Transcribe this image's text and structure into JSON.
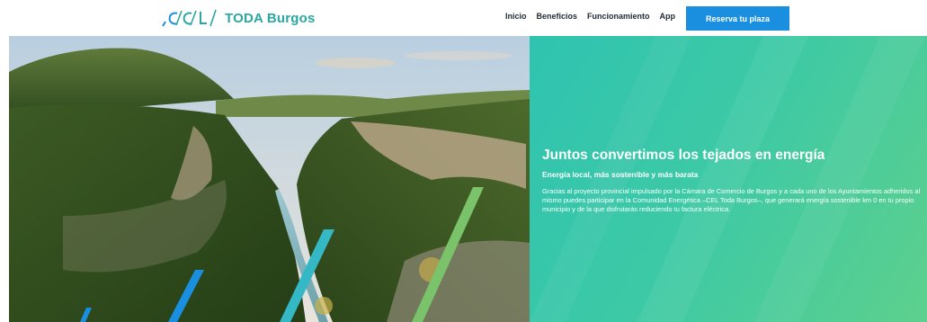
{
  "header": {
    "logo": {
      "mark_text": ",C/C/L",
      "brand": "TODA Burgos",
      "icon": "cel-logo-icon",
      "mark_color": "#1a8fe0",
      "brand_color": "#2aa7a0"
    },
    "nav": [
      {
        "label": "Inicio"
      },
      {
        "label": "Beneficios"
      },
      {
        "label": "Funcionamiento"
      },
      {
        "label": "App"
      }
    ],
    "cta_label": "Reserva tu plaza"
  },
  "hero": {
    "image_description_icon": "canyon-landscape-image",
    "title": "Juntos convertimos los tejados en energía",
    "subtitle": "Energía local, más sostenible y más barata",
    "body": "Gracias al proyecto provincial impulsado por la Cámara de Comercio de Burgos y a cada uno de los Ayuntamientos adheridos al mismo puedes participar en la Comunidad Energética –CEL Toda Burgos–, que generará energía sostenible km 0 en tu propio municipio y de la que disfrutarás reduciendo tu factura eléctrica."
  },
  "colors": {
    "accent_blue": "#1a8fe0",
    "panel_teal": "#2fc3b0",
    "panel_green": "#5dd08d",
    "stripe_green": "#7ac36a",
    "stripe_cyan": "#34b8c6"
  }
}
